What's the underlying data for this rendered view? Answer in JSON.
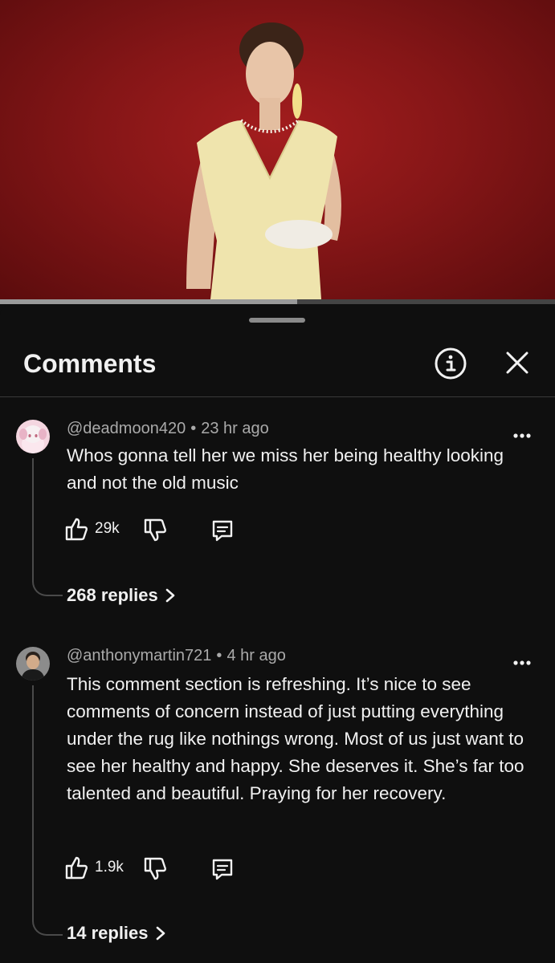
{
  "video": {
    "progress_fraction": 0.535
  },
  "sheet": {
    "title": "Comments",
    "info_icon": "info-circle-icon",
    "close_icon": "close-icon"
  },
  "comments": [
    {
      "author": "@deadmoon420",
      "time": "23 hr ago",
      "text": "Whos gonna tell her we miss her being healthy looking and not the old music",
      "likes": "29k",
      "replies_label": "268 replies"
    },
    {
      "author": "@anthonymartin721",
      "time": "4 hr ago",
      "text": "This comment section is refreshing. It’s nice to see comments of concern instead of just putting everything under the rug like nothings wrong. Most of us just want to see her healthy and happy. She deserves it. She’s far too talented and beautiful. Praying for her recovery.",
      "likes": "1.9k",
      "replies_label": "14 replies"
    }
  ],
  "colors": {
    "background": "#0f0f0f",
    "video_backdrop": "#8a1718",
    "text_primary": "#f1f1f1",
    "text_secondary": "#aaaaaa"
  }
}
